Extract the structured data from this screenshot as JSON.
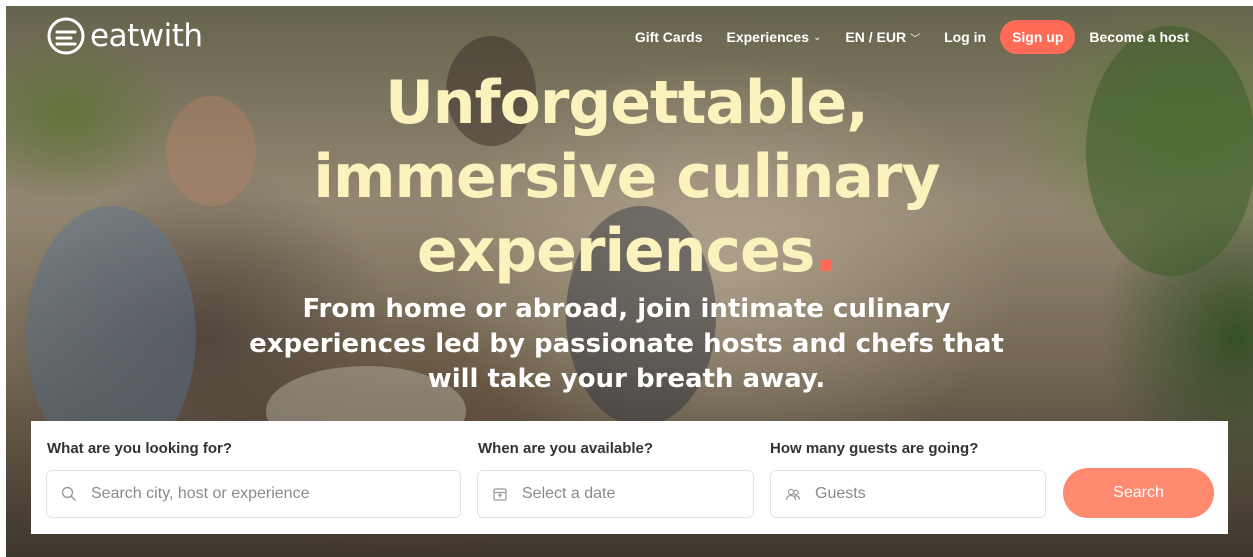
{
  "brand": {
    "name": "eatwith",
    "accent": "#ff6b57"
  },
  "nav": {
    "gift_cards": "Gift Cards",
    "experiences": "Experiences",
    "language_currency": "EN / EUR",
    "login": "Log in",
    "signup": "Sign up",
    "become_host": "Become a host"
  },
  "hero": {
    "headline_line1": "Unforgettable,",
    "headline_line2": "immersive culinary",
    "headline_line3": "experiences",
    "headline_dot": ".",
    "sub_line1": "From home or abroad, join intimate culinary",
    "sub_line2": "experiences led by passionate hosts and chefs that",
    "sub_line3": "will take your breath away."
  },
  "search": {
    "what_label": "What are you looking for?",
    "what_placeholder": "Search city, host or experience",
    "when_label": "When are you available?",
    "when_placeholder": "Select a date",
    "guests_label": "How many guests are going?",
    "guests_placeholder": "Guests",
    "button": "Search"
  },
  "icons": {
    "search": "search-icon",
    "calendar": "calendar-icon",
    "guests": "guests-icon",
    "chevron": "chevron-down-icon"
  }
}
